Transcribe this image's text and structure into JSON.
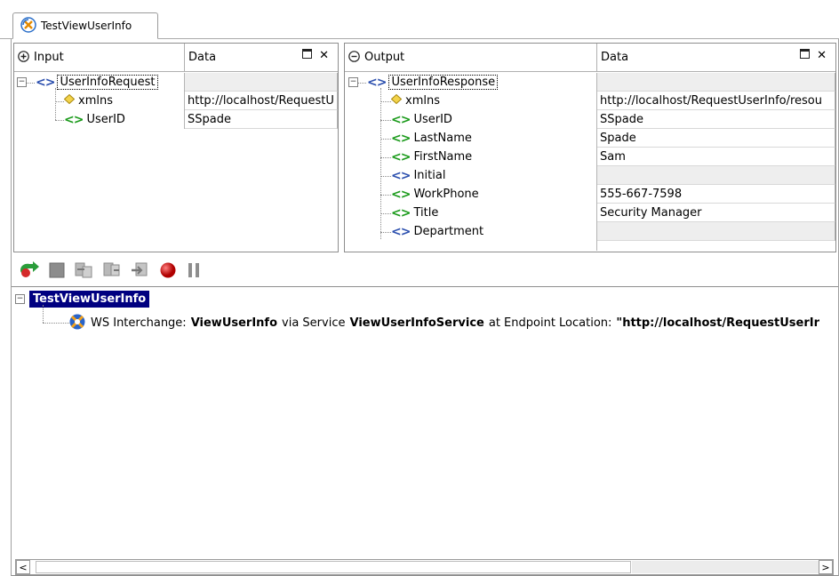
{
  "tab": {
    "title": "TestViewUserInfo"
  },
  "input_pane": {
    "header_label": "Input",
    "data_header": "Data",
    "rows": [
      {
        "label": "UserInfoRequest",
        "value": ""
      },
      {
        "label": "xmlns",
        "value": "http://localhost/RequestU"
      },
      {
        "label": "UserID",
        "value": "SSpade"
      }
    ]
  },
  "output_pane": {
    "header_label": "Output",
    "data_header": "Data",
    "rows": [
      {
        "label": "UserInfoResponse",
        "value": ""
      },
      {
        "label": "xmlns",
        "value": "http://localhost/RequestUserInfo/resou"
      },
      {
        "label": "UserID",
        "value": "SSpade"
      },
      {
        "label": "LastName",
        "value": "Spade"
      },
      {
        "label": "FirstName",
        "value": "Sam"
      },
      {
        "label": "Initial",
        "value": ""
      },
      {
        "label": "WorkPhone",
        "value": "555-667-7598"
      },
      {
        "label": "Title",
        "value": "Security Manager"
      },
      {
        "label": "Department",
        "value": ""
      }
    ]
  },
  "tree": {
    "root": "TestViewUserInfo",
    "child": {
      "prefix": "WS Interchange:",
      "operation": "ViewUserInfo",
      "via_text": "via Service",
      "service": "ViewUserInfoService",
      "at_text": "at Endpoint Location:",
      "endpoint": "\"http://localhost/RequestUserIr"
    }
  },
  "colors": {
    "selection": "#000080",
    "tag_green": "#1a9a1a",
    "tag_blue": "#2b4fae"
  },
  "icons": [
    "run-icon",
    "stop-icon",
    "step-into-icon",
    "step-over-icon",
    "step-out-icon",
    "breakpoint-icon",
    "pause-icon"
  ]
}
